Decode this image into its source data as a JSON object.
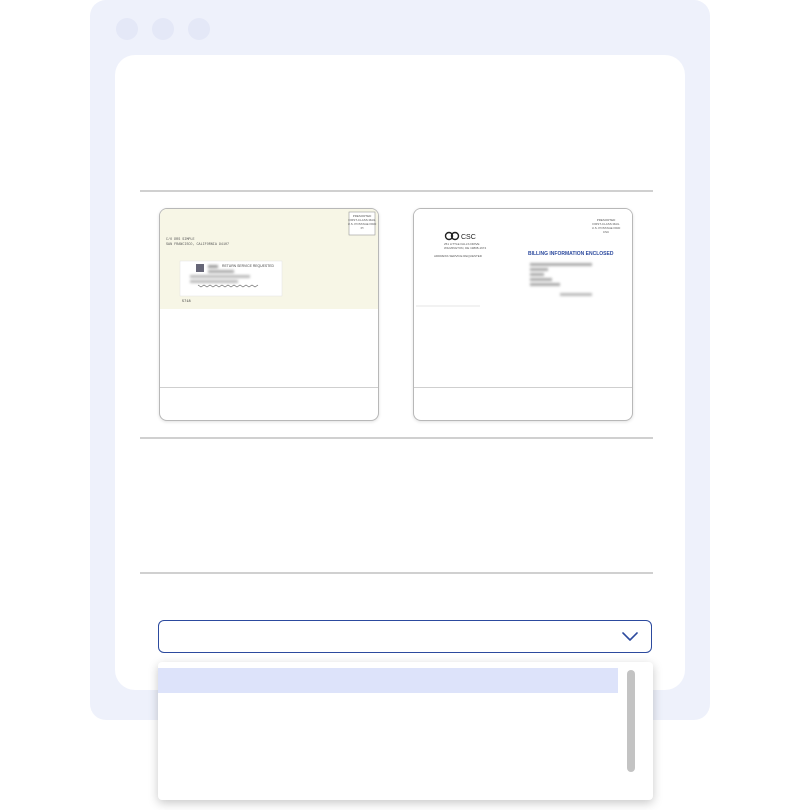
{
  "card_left": {
    "return_address": [
      "C/O DRS SIMPLE",
      "SAN FRANCISCO, CALIFORNIA 94107"
    ],
    "postage_stamp": [
      "PRESORTED",
      "FIRST-CLASS MAIL",
      "U.S. POSTAGE PAID",
      "PI"
    ],
    "endorsement": "RETURN SERVICE REQUESTED",
    "code": "5718"
  },
  "card_right": {
    "logo_text": "CSC",
    "sender_address": [
      "251 LITTLE FALLS DRIVE",
      "WILMINGTON, DE 19808-1674"
    ],
    "service_line": "ADDRESS SERVICE REQUESTED",
    "postage_stamp": [
      "PRESORTED",
      "FIRST-CLASS MAIL",
      "U.S. POSTAGE PAID",
      "CSC"
    ],
    "headline": "BILLING INFORMATION ENCLOSED"
  },
  "select": {
    "value": "",
    "options": [
      ""
    ]
  }
}
